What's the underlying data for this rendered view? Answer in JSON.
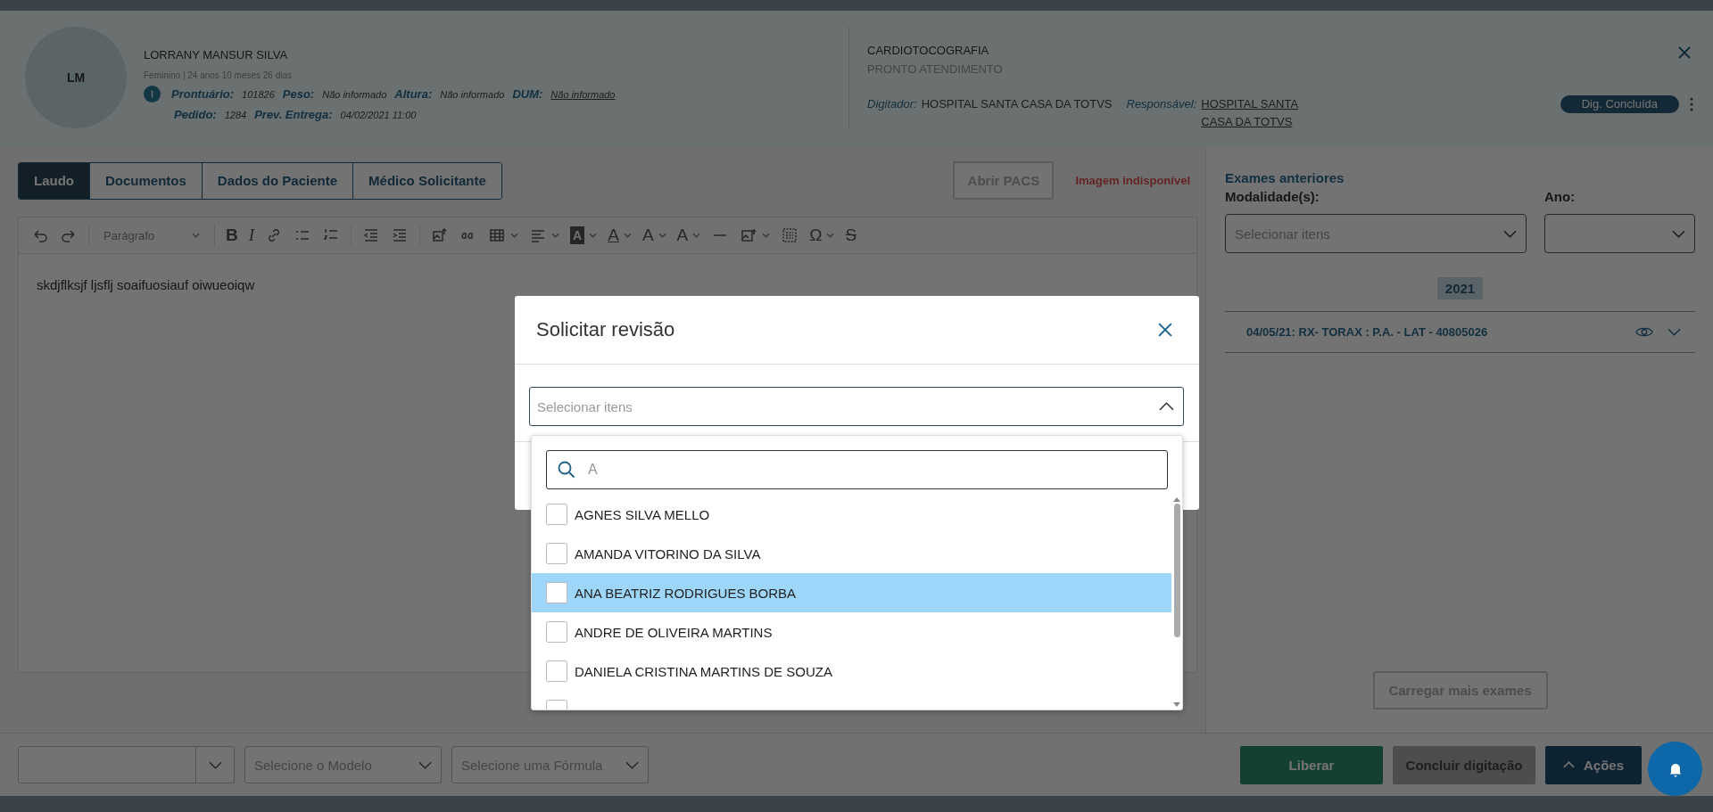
{
  "header": {
    "avatar": "LM",
    "name": "LORRANY MANSUR SILVA",
    "demographics": "Feminino | 24 anos 10 meses 26 dias",
    "fields": [
      {
        "label": "Prontuário:",
        "value": "101826",
        "link": false
      },
      {
        "label": "Peso:",
        "value": "Não informado",
        "link": false
      },
      {
        "label": "Altura:",
        "value": "Não informado",
        "link": false
      },
      {
        "label": "DUM:",
        "value": "Não informado",
        "link": true
      }
    ],
    "fields_2": [
      {
        "label": "Pedido:",
        "value": "1284",
        "link": false
      },
      {
        "label": "Prev. Entrega:",
        "value": "04/02/2021 11:00",
        "link": false
      }
    ],
    "exam": "CARDIOTOCOGRAFIA",
    "sector": "PRONTO ATENDIMENTO",
    "digitador": {
      "label": "Digitador:",
      "value": "HOSPITAL SANTA CASA DA TOTVS",
      "link": false
    },
    "responsavel": {
      "label": "Responsável:",
      "value": "HOSPITAL SANTA CASA DA TOTVS",
      "link": true
    },
    "status": "Dig. Concluída"
  },
  "tabs": [
    {
      "label": "Laudo",
      "selected": true
    },
    {
      "label": "Documentos",
      "selected": false
    },
    {
      "label": "Dados do Paciente",
      "selected": false
    },
    {
      "label": "Médico Solicitante",
      "selected": false
    }
  ],
  "pacs_button": {
    "label": "Abrir PACS",
    "disabled": true
  },
  "image_message": "Imagem indisponível",
  "toolbar": {
    "paragraph": "Parágrafo",
    "glyphs": [
      "B",
      "I",
      "A",
      "A",
      "A",
      "A",
      "Ω",
      "S"
    ]
  },
  "editor_text": "skdjflksjf ljsflj soaifuosiauf oiwueoiqw",
  "previous_exams": {
    "title": "Exames anteriores",
    "modality_label": "Modalidade(s):",
    "modality_placeholder": "Selecionar itens",
    "year_label": "Ano:",
    "year_group": "2021",
    "items": [
      {
        "text": "04/05/21: RX- TORAX : P.A. - LAT - 40805026"
      }
    ],
    "load_more": "Carregar mais exames"
  },
  "footer": {
    "template_placeholder": "Selecione o Modelo",
    "formula_placeholder": "Selecione uma Fórmula",
    "buttons": [
      {
        "label": "Liberar",
        "kind": "primary"
      },
      {
        "label": "Concluir digitação",
        "kind": "secondary"
      },
      {
        "label": "Ações",
        "kind": "menu"
      }
    ]
  },
  "modal": {
    "title": "Solicitar revisão",
    "select_placeholder": "Selecionar itens",
    "expanded": true,
    "search_value": "A",
    "options": [
      {
        "label": "AGNES SILVA MELLO",
        "checked": false,
        "selected": false
      },
      {
        "label": "AMANDA VITORINO DA SILVA",
        "checked": false,
        "selected": false
      },
      {
        "label": "ANA BEATRIZ RODRIGUES BORBA",
        "checked": false,
        "selected": true
      },
      {
        "label": "ANDRE DE OLIVEIRA MARTINS",
        "checked": false,
        "selected": false
      },
      {
        "label": "DANIELA CRISTINA MARTINS DE SOUZA",
        "checked": false,
        "selected": false
      }
    ]
  }
}
